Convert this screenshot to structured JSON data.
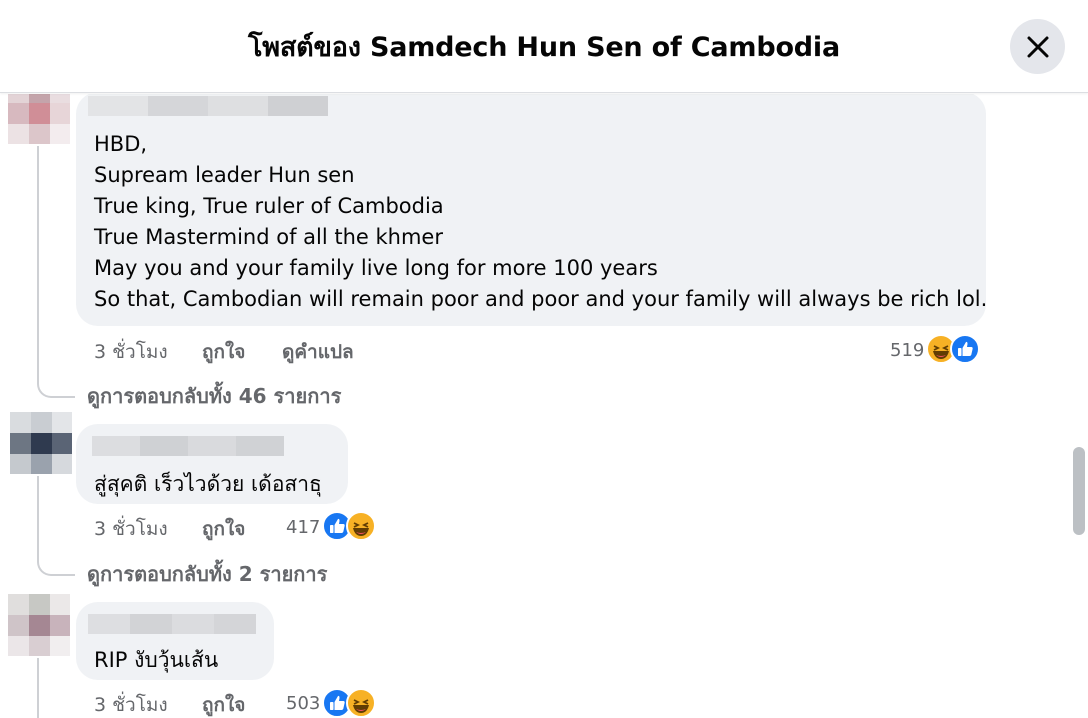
{
  "dialog": {
    "title": "โพสต์ของ Samdech Hun Sen of Cambodia",
    "close_icon": "close-icon"
  },
  "comments": [
    {
      "lines": [
        "HBD,",
        "Supream leader Hun sen",
        "True king, True ruler of Cambodia",
        "True Mastermind of all the khmer",
        "May you and your family live long for more 100 years",
        "So that, Cambodian will remain poor and poor and your family will always be rich lol."
      ],
      "time": "3 ชั่วโมง",
      "like": "ถูกใจ",
      "translate": "ดูคำแปล",
      "reaction_count": "519",
      "reactions": [
        "haha-icon",
        "like-icon"
      ],
      "view_replies": "ดูการตอบกลับทั้ง 46 รายการ"
    },
    {
      "lines": [
        "สู่สุคติ เร็วไวด้วย เด้อสาธุ"
      ],
      "time": "3 ชั่วโมง",
      "like": "ถูกใจ",
      "reaction_count": "417",
      "reactions": [
        "like-icon",
        "haha-icon"
      ],
      "view_replies": "ดูการตอบกลับทั้ง 2 รายการ"
    },
    {
      "lines": [
        "RIP งับวุ้นเส้น"
      ],
      "time": "3 ชั่วโมง",
      "like": "ถูกใจ",
      "reaction_count": "503",
      "reactions": [
        "like-icon",
        "haha-icon"
      ]
    }
  ],
  "colors": {
    "bubble": "#f0f2f5",
    "meta_text": "#65676b",
    "like_blue": "#1877f2",
    "haha_yellow": "#f7b125"
  }
}
